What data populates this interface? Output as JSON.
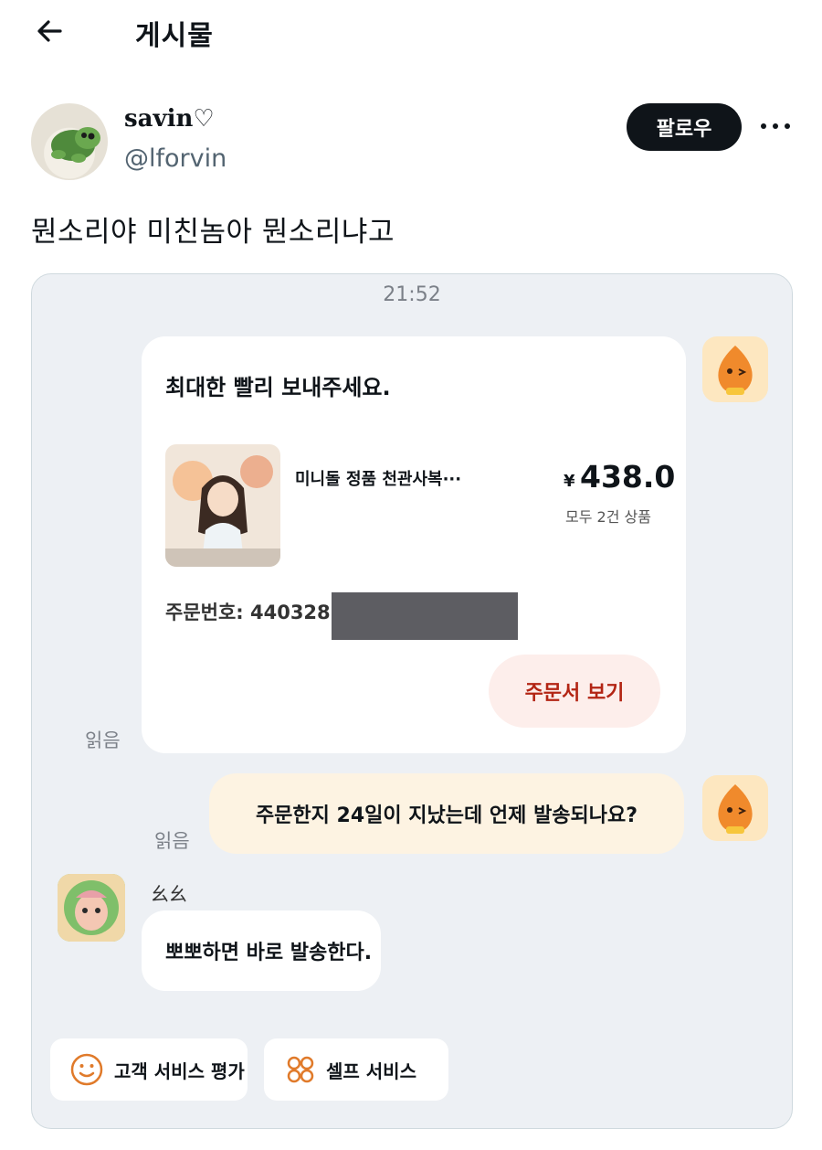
{
  "header": {
    "title": "게시물",
    "back_icon": "arrow-left-icon"
  },
  "post": {
    "author": {
      "display_name": "savin♡",
      "handle": "@lforvin"
    },
    "follow_label": "팔로우",
    "more_icon": "more-horizontal-icon",
    "text": "뭔소리야 미친놈아 뭔소리냐고"
  },
  "chat": {
    "time": "21:52",
    "order_card": {
      "message": "최대한 빨리 보내주세요.",
      "product_name": "미니돌 정품 천관사복···",
      "currency": "¥",
      "price": "438.0",
      "quantity": "모두 2건 상품",
      "order_number": "주문번호: 440328",
      "view_order": "주문서 보기"
    },
    "read_label": "읽음",
    "question": "주문한지 24일이 지났는데 언제 발송되나요?",
    "seller_name": "幺幺",
    "reply": "뽀뽀하면 바로 발송한다.",
    "actions": {
      "rate": "고객 서비스 평가",
      "self": "셀프 서비스"
    },
    "colors": {
      "accent_red": "#b32514",
      "bubble_cream": "#fdf3e2",
      "chat_bg": "#edf0f4"
    }
  }
}
